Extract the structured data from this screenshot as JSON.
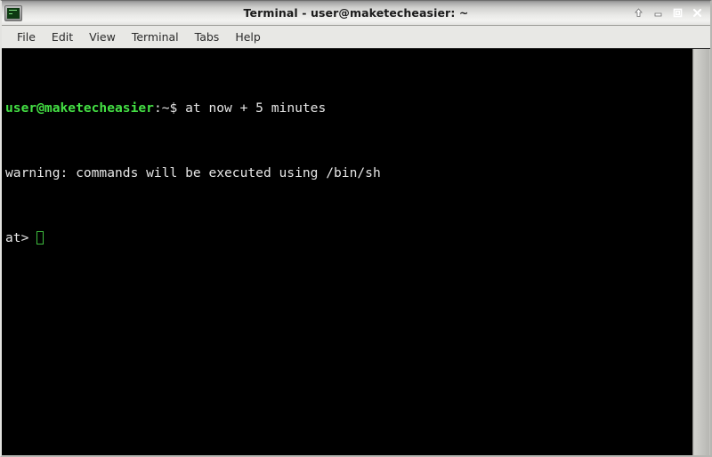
{
  "window": {
    "title": "Terminal - user@maketecheasier: ~",
    "icon": "terminal-icon"
  },
  "window_controls": [
    {
      "name": "shade-button",
      "icon": "up-arrow-icon",
      "label": "↑"
    },
    {
      "name": "minimize-button",
      "icon": "minimize-icon",
      "label": "–"
    },
    {
      "name": "maximize-button",
      "icon": "maximize-icon",
      "label": "□"
    },
    {
      "name": "close-button",
      "icon": "close-icon",
      "label": "✕"
    }
  ],
  "menubar": {
    "items": [
      {
        "label": "File"
      },
      {
        "label": "Edit"
      },
      {
        "label": "View"
      },
      {
        "label": "Terminal"
      },
      {
        "label": "Tabs"
      },
      {
        "label": "Help"
      }
    ]
  },
  "terminal": {
    "colors": {
      "background": "#000000",
      "foreground": "#e6e6e6",
      "prompt_green": "#44e044",
      "cursor_outline": "#3fbd3f"
    },
    "lines": [
      {
        "type": "command",
        "prompt_user": "user@maketecheasier",
        "prompt_sep": ":~$ ",
        "command": "at now + 5 minutes"
      },
      {
        "type": "output",
        "text": "warning: commands will be executed using /bin/sh"
      },
      {
        "type": "prompt",
        "text": "at> "
      }
    ]
  }
}
